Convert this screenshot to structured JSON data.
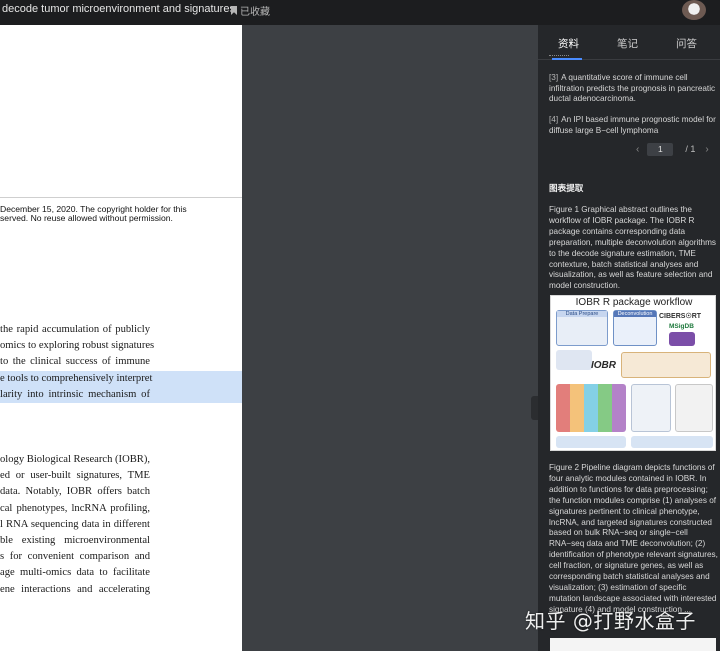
{
  "header": {
    "title": "decode tumor microenvironment and signatures",
    "saved_label": "已收藏"
  },
  "pdf": {
    "copyright": [
      "December 15, 2020. The copyright holder for this",
      "served. No reuse allowed without permission."
    ],
    "para1": [
      "the rapid accumulation of publicly",
      "omics to exploring robust signatures",
      "to the clinical success of immune",
      "e tools to comprehensively interpret",
      "larity into intrinsic mechanism of"
    ],
    "para2": [
      "ology Biological Research (IOBR),",
      "ed or user-built signatures, TME",
      "data. Notably, IOBR offers batch",
      "cal phenotypes, lncRNA profiling,",
      "l RNA sequencing data in different",
      "ble existing microenvironmental",
      "s for convenient comparison and",
      "age multi-omics data to facilitate",
      "ene interactions and accelerating"
    ]
  },
  "panel": {
    "tabs": [
      "资料",
      "笔记",
      "问答"
    ],
    "active_tab": "资料",
    "references": [
      {
        "num": "[3]",
        "text": "A quantitative score of immune cell infiltration predicts the prognosis in pancreatic ductal adenocarcinoma."
      },
      {
        "num": "[4]",
        "text": "An IPI based immune prognostic model for diffuse large B−cell lymphoma"
      }
    ],
    "pager": {
      "current": "1",
      "total": "/ 1",
      "prev": "‹",
      "next": "›"
    },
    "section_title": "图表提取",
    "figure1_caption": "Figure 1 Graphical abstract outlines the workflow of IOBR package. The IOBR R package contains corresponding data preparation, multiple deconvolution algorithms to the decode signature estimation, TME contexture, batch statistical analyses and visualization, as well as feature selection and model construction.",
    "figure1_title": "IOBR R package workflow",
    "figure1_labels": {
      "data_prepare": "Data Prepare",
      "deconvolution": "Deconvolution",
      "cibersort": "CIBERS☉RT",
      "msigdb": "MSigDB",
      "iobr": "IOBR"
    },
    "figure2_caption": "Figure 2 Pipeline diagram depicts functions of four analytic modules contained in IOBR. In addition to functions for data preprocessing; the function modules comprise (1) analyses of signatures pertinent to clinical phenotype, lncRNA, and targeted signatures constructed based on bulk RNA−seq or single−cell RNA−seq data and TME deconvolution; (2) identification of phenotype relevant signatures, cell fraction, or signature genes, as well as corresponding batch statistical analyses and visualization; (3) estimation of specific mutation landscape associated with interested signature (4) and model construction ..."
  },
  "watermark": "知乎 @打野水盒子",
  "colors": {
    "accent": "#4a8cff",
    "highlight": "#cfe1f8",
    "panel_bg": "#25272a"
  }
}
